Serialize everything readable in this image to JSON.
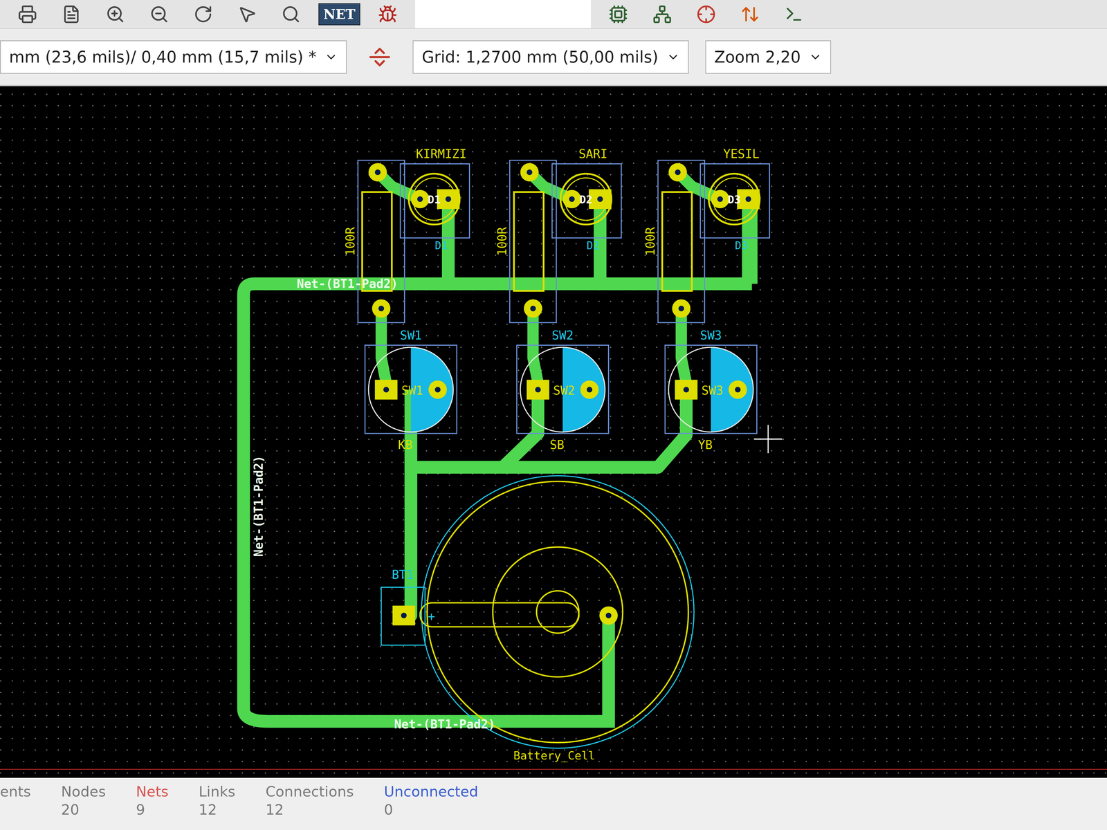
{
  "toolbar": {
    "net_button": "NET"
  },
  "options_bar": {
    "track_via": "mm (23,6 mils)/ 0,40 mm (15,7 mils) *",
    "grid": "Grid: 1,2700 mm (50,00 mils)",
    "zoom": "Zoom 2,20"
  },
  "board": {
    "channels": [
      {
        "led_label": "KIRMIZI",
        "led_ref": "D1",
        "resistor": "100R",
        "switch_ref": "SW1",
        "button_label": "KB"
      },
      {
        "led_label": "SARI",
        "led_ref": "D2",
        "resistor": "100R",
        "switch_ref": "SW2",
        "button_label": "SB"
      },
      {
        "led_label": "YESIL",
        "led_ref": "D3",
        "resistor": "100R",
        "switch_ref": "SW3",
        "button_label": "YB"
      }
    ],
    "net_labels": [
      "Net-(BT1-Pad2)",
      "Net-(BT1-Pad2)",
      "Net-(BT1-Pad2)"
    ],
    "battery": {
      "ref": "BT1",
      "plus": "+",
      "value": "Battery_Cell"
    }
  },
  "status_bar": [
    {
      "label": "ents",
      "color": "#7a7a7a"
    },
    {
      "label": "Nodes",
      "value": "20",
      "color": "#7a7a7a"
    },
    {
      "label": "Nets",
      "value": "9",
      "color": "#d9534f"
    },
    {
      "label": "Links",
      "value": "12",
      "color": "#7a7a7a"
    },
    {
      "label": "Connections",
      "value": "12",
      "color": "#7a7a7a"
    },
    {
      "label": "Unconnected",
      "value": "0",
      "color": "#3a5fcd"
    }
  ]
}
